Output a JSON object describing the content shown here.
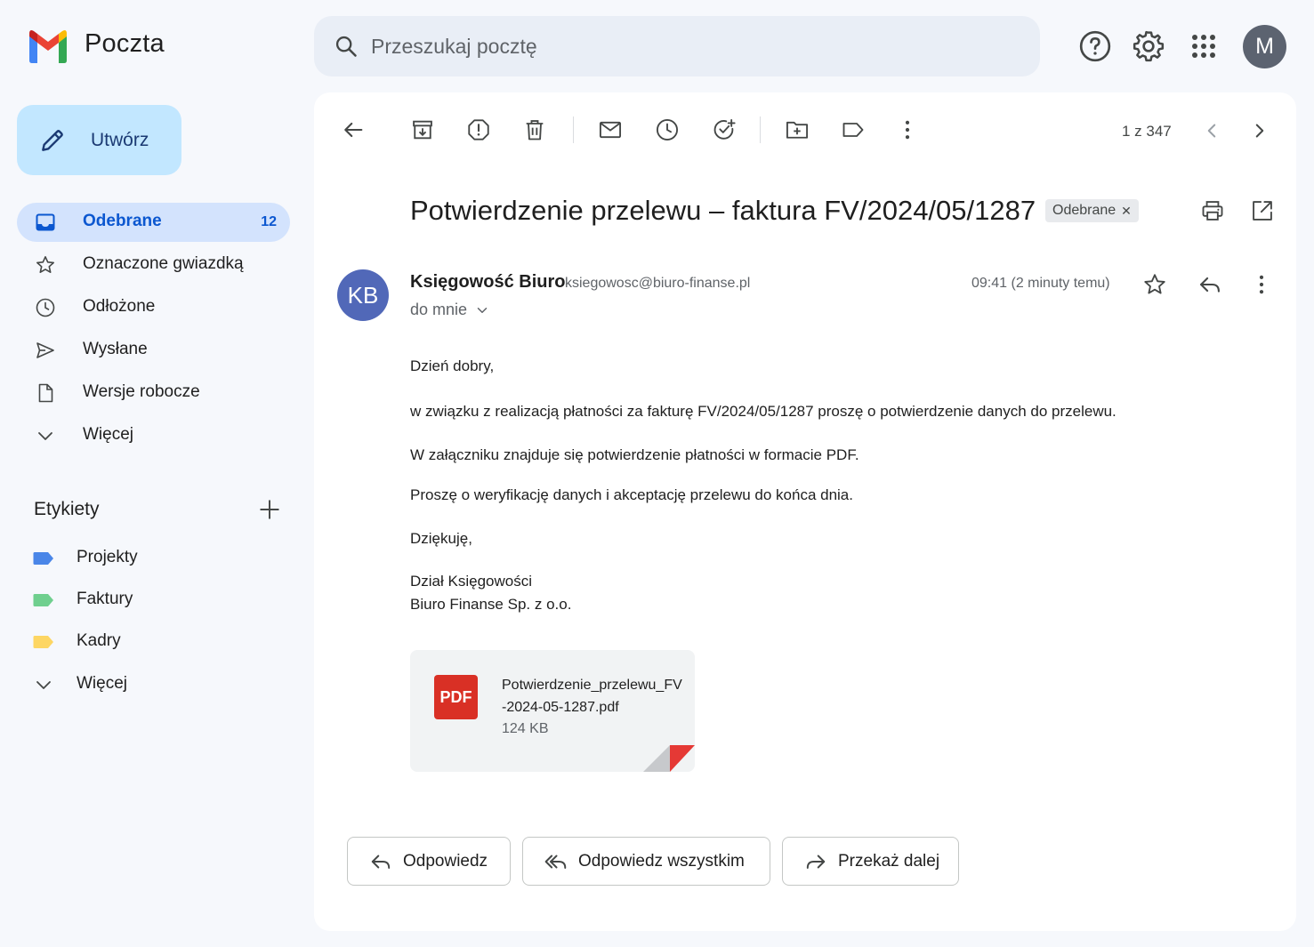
{
  "app": {
    "title": "Poczta",
    "search_placeholder": "Przeszukaj pocztę",
    "avatar_initial": "M"
  },
  "sidebar": {
    "compose_label": "Utwórz",
    "nav": [
      {
        "label": "Odebrane",
        "count": "12",
        "icon": "inbox-icon",
        "active": true
      },
      {
        "label": "Oznaczone gwiazdką",
        "icon": "star-icon"
      },
      {
        "label": "Odłożone",
        "icon": "clock-icon"
      },
      {
        "label": "Wysłane",
        "icon": "send-icon"
      },
      {
        "label": "Wersje robocze",
        "icon": "draft-icon"
      },
      {
        "label": "Więcej",
        "icon": "chevron-down-icon"
      }
    ],
    "labels_title": "Etykiety",
    "labels": [
      {
        "label": "Projekty",
        "color": "#4a86e8"
      },
      {
        "label": "Faktury",
        "color": "#6fcf8e"
      },
      {
        "label": "Kadry",
        "color": "#fdd663"
      }
    ],
    "labels_more": "Więcej"
  },
  "toolbar": {
    "pager": "1 z 347"
  },
  "email": {
    "subject": "Potwierdzenie przelewu – faktura FV/2024/05/1287",
    "chip": "Odebrane",
    "sender_initials": "KB",
    "sender_name": "Księgowość Biuro",
    "sender_email": "ksiegowosc@biuro-finanse.pl",
    "to": "do mnie",
    "time": "09:41 (2 minuty temu)",
    "body": {
      "greeting": "Dzień dobry,",
      "p1": "w związku z realizacją płatności za fakturę FV/2024/05/1287 proszę o potwierdzenie danych do przelewu.",
      "p2": "W załączniku znajduje się potwierdzenie płatności w formacie PDF.",
      "p3": "Proszę o weryfikację danych i akceptację przelewu do końca dnia.",
      "thanks": "Dziękuję,",
      "sig1": "Dział Księgowości",
      "sig2": "Biuro Finanse Sp. z o.o."
    },
    "attachment": {
      "badge": "PDF",
      "name": "Potwierdzenie_przelewu_FV-2024-05-1287.pdf",
      "size": "124 KB"
    }
  },
  "actions": {
    "reply": "Odpowiedz",
    "reply_all": "Odpowiedz wszystkim",
    "forward": "Przekaż dalej"
  },
  "colors": {
    "accent": "#0b57d0",
    "compose_bg": "#c2e7ff",
    "active_nav_bg": "#d3e3fd",
    "pdf_red": "#d93025"
  }
}
